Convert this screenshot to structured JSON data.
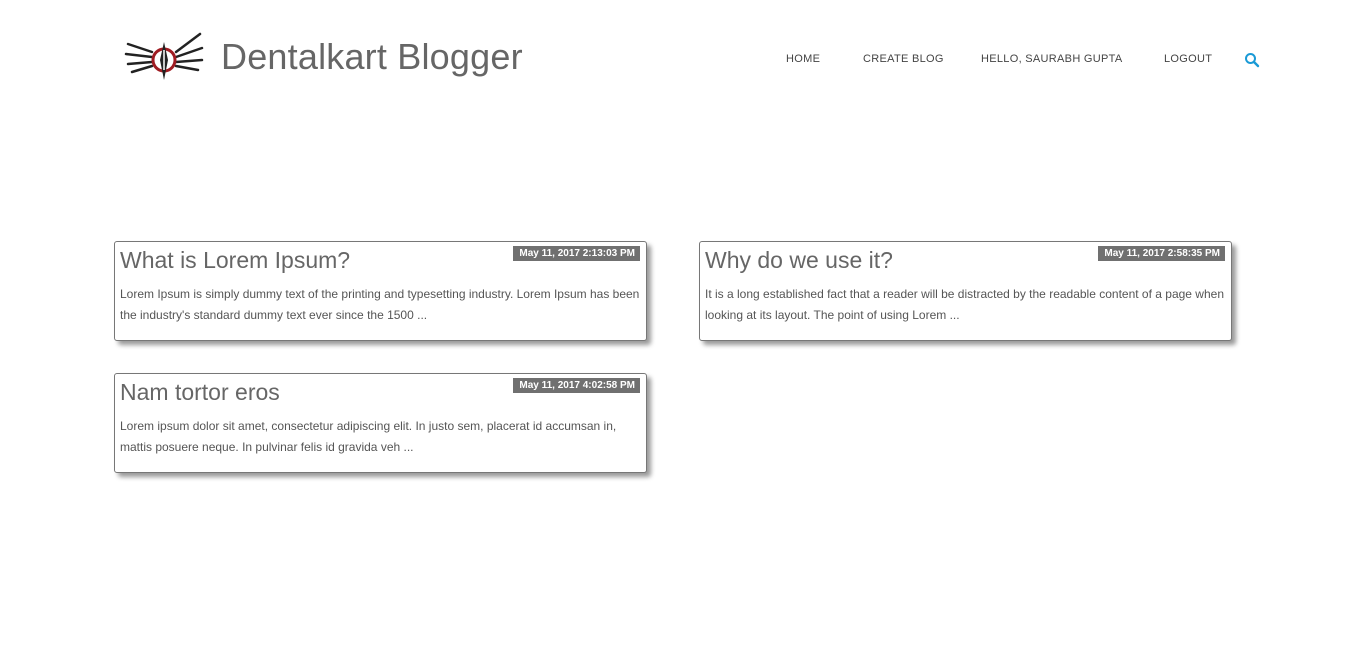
{
  "header": {
    "brand": "Dentalkart Blogger",
    "logo_icon": "winged-emblem-logo",
    "accent_color": "#1a9ad6",
    "logo_accent_color": "#a01c22"
  },
  "nav": {
    "home": "HOME",
    "create_blog": "CREATE BLOG",
    "hello": "HELLO,  SAURABH GUPTA",
    "logout": "LOGOUT",
    "search_icon": "search-icon"
  },
  "posts": [
    {
      "title": "What is Lorem Ipsum?",
      "date": "May 11, 2017 2:13:03 PM",
      "excerpt": "Lorem Ipsum is simply dummy text of the printing and typesetting industry. Lorem Ipsum has been the industry's standard dummy text ever since the 1500 ..."
    },
    {
      "title": "Why do we use it?",
      "date": "May 11, 2017 2:58:35 PM",
      "excerpt": "It is a long established fact that a reader will be distracted by the readable content of a page when looking at its layout. The point of using Lorem ..."
    },
    {
      "title": "Nam tortor eros",
      "date": "May 11, 2017 4:02:58 PM",
      "excerpt": "Lorem ipsum dolor sit amet, consectetur adipiscing elit. In justo sem, placerat id accumsan in, mattis posuere neque. In pulvinar felis id gravida veh ..."
    }
  ]
}
